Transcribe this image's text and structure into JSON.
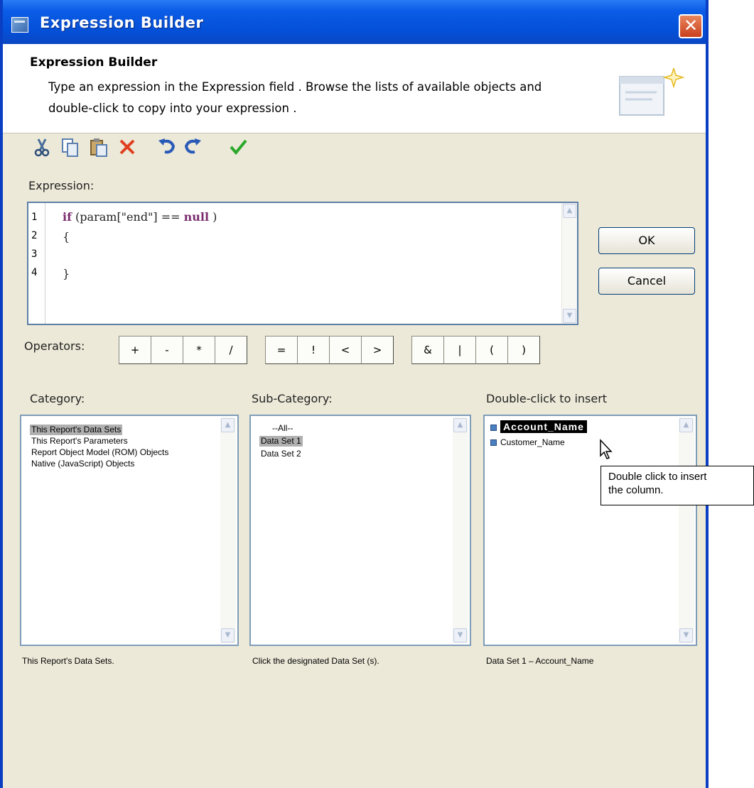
{
  "window": {
    "title": "Expression Builder",
    "close_glyph": "✕"
  },
  "banner": {
    "title": "Expression Builder",
    "description": "Type an expression in the Expression field . Browse the lists of available objects and double-click to copy into your expression ."
  },
  "toolbar": {
    "items": [
      "cut-icon",
      "copy-icon",
      "paste-icon",
      "delete-icon",
      "undo-icon",
      "redo-icon",
      "validate-icon"
    ],
    "colors": {
      "scissors": "#4a6e9a",
      "delete": "#e04020",
      "undo": "#2a5ab8",
      "validate": "#2aa82a"
    }
  },
  "expression": {
    "label": "Expression:",
    "line_numbers": [
      "1",
      "2",
      "3",
      "4"
    ],
    "lines": [
      {
        "kw1": "if",
        "mid": " (param[\"end\"] == ",
        "kw2": "null",
        "end": " )"
      },
      {
        "text": "{"
      },
      {
        "text": ""
      },
      {
        "text": "}"
      }
    ]
  },
  "buttons": {
    "ok": "OK",
    "cancel": "Cancel"
  },
  "operators": {
    "label": "Operators:",
    "items": [
      "+",
      "-",
      "*",
      "/",
      "=",
      "!",
      "<",
      ">",
      "&",
      "|",
      "(",
      ")"
    ]
  },
  "category": {
    "label": "Category:",
    "items": [
      "This Report's Data Sets",
      "This Report's Parameters",
      "Report Object Model (ROM) Objects",
      "Native (JavaScript) Objects"
    ],
    "selected_index": 0,
    "status": "This Report's Data Sets."
  },
  "subcategory": {
    "label": "Sub-Category:",
    "items": [
      "--All--",
      "Data Set 1",
      "Data Set 2"
    ],
    "selected_index": 1,
    "status": "Click the designated Data Set (s)."
  },
  "insert": {
    "label": "Double-click to insert",
    "items": [
      "Account_Name",
      "Customer_Name"
    ],
    "highlighted_index": 0,
    "status": "Data Set 1 – Account_Name"
  },
  "tooltip": {
    "line1": "Double click to insert",
    "line2": "the column."
  }
}
